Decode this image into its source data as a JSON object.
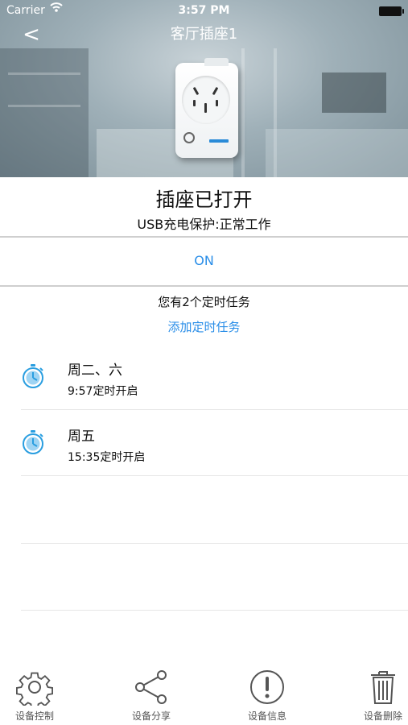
{
  "status_bar": {
    "carrier": "Carrier",
    "time": "3:57 PM"
  },
  "nav": {
    "back_symbol": "<",
    "title": "客厅插座1"
  },
  "device": {
    "state_title": "插座已打开",
    "usb_status": "USB充电保护:正常工作",
    "power_button_label": "ON"
  },
  "timers": {
    "summary": "您有2个定时任务",
    "add_label": "添加定时任务",
    "items": [
      {
        "days": "周二、六",
        "time": "9:57定时开启",
        "icon": "stopwatch-icon"
      },
      {
        "days": "周五",
        "time": "15:35定时开启",
        "icon": "stopwatch-icon"
      }
    ]
  },
  "tab_bar": {
    "items": [
      {
        "label": "设备控制",
        "icon": "gear-icon"
      },
      {
        "label": "设备分享",
        "icon": "share-icon"
      },
      {
        "label": "设备信息",
        "icon": "info-exclamation-icon"
      },
      {
        "label": "设备删除",
        "icon": "trash-icon"
      }
    ]
  },
  "colors": {
    "accent": "#2a8ee8",
    "timer_icon": "#2a9ee0",
    "tab_icon": "#555555"
  }
}
